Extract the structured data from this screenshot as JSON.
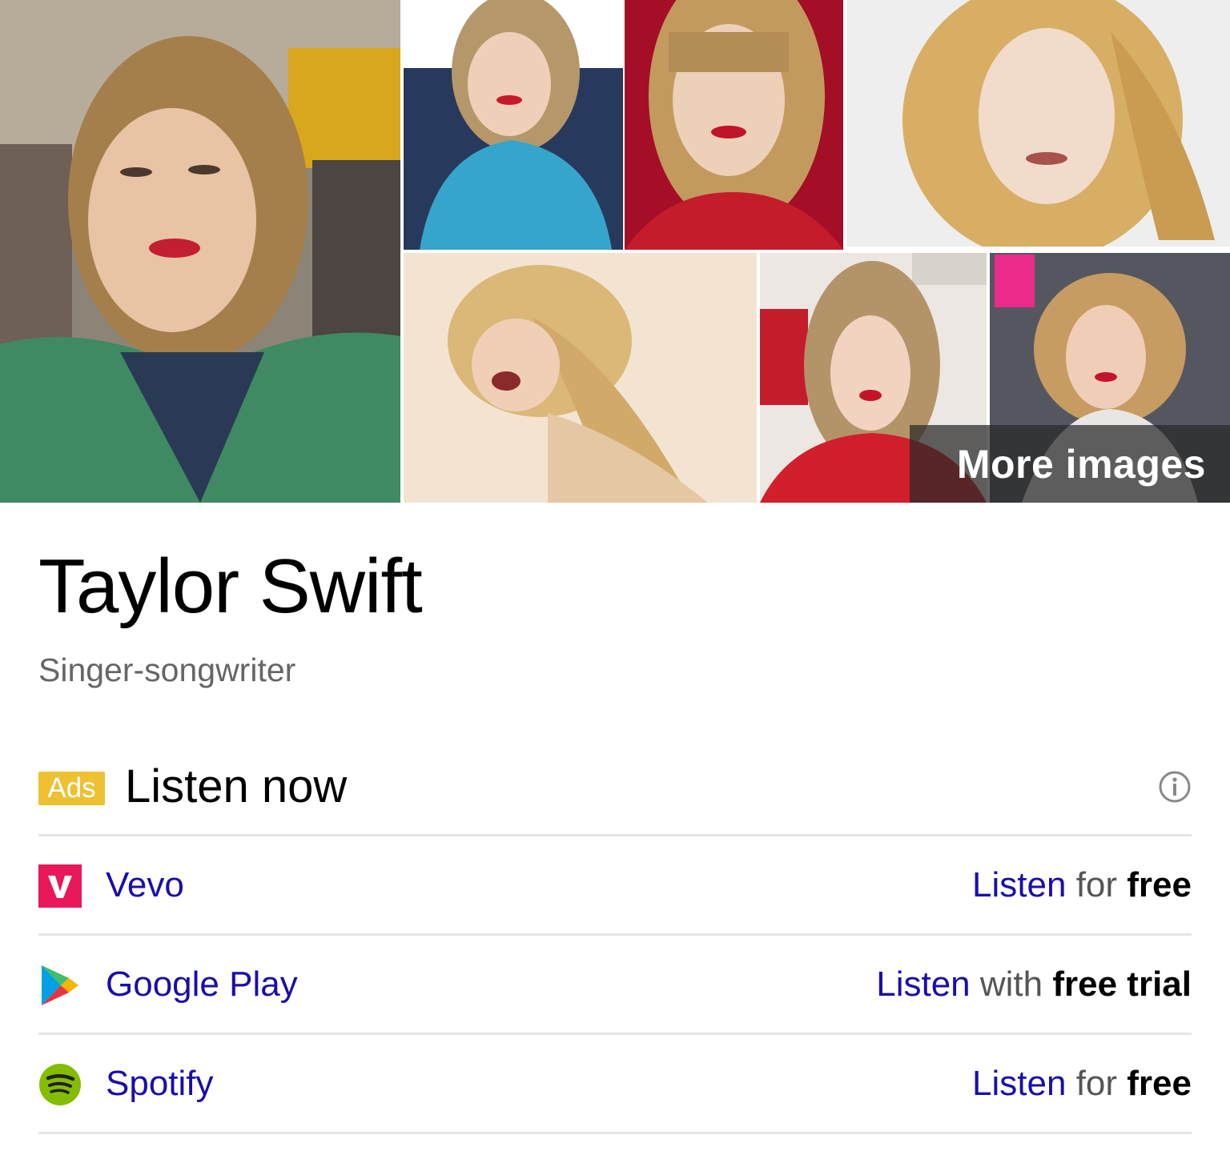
{
  "gallery": {
    "more_images_label": "More images"
  },
  "entity": {
    "title": "Taylor Swift",
    "subtitle": "Singer-songwriter"
  },
  "ads": {
    "badge": "Ads",
    "heading": "Listen now",
    "accent_color": "#edc132"
  },
  "listen_options": [
    {
      "provider": "Vevo",
      "icon": "vevo-icon",
      "cta_link": "Listen",
      "cta_middle": "for",
      "cta_bold": "free"
    },
    {
      "provider": "Google Play",
      "icon": "google-play-icon",
      "cta_link": "Listen",
      "cta_middle": "with",
      "cta_bold": "free trial"
    },
    {
      "provider": "Spotify",
      "icon": "spotify-icon",
      "cta_link": "Listen",
      "cta_middle": "for",
      "cta_bold": "free"
    }
  ],
  "colors": {
    "link": "#1a0dab",
    "vevo": "#e8185a",
    "spotify": "#84bd00"
  }
}
